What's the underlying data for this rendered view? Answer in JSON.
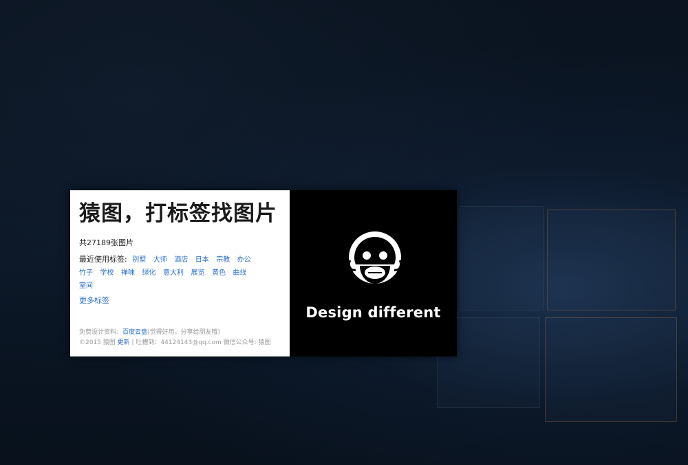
{
  "colors": {
    "link": "#2a6fc9",
    "panel_left_bg": "#ffffff",
    "panel_right_bg": "#000000",
    "wallpaper": "#07101c"
  },
  "card": {
    "title": "猿图，打标签找图片",
    "count_text": "共27189张图片",
    "recent_tags_label": "最近使用标签:",
    "tags": [
      "别墅",
      "大师",
      "酒店",
      "日本",
      "宗教",
      "办公",
      "竹子",
      "学校",
      "禅味",
      "绿化",
      "意大利",
      "展览",
      "黄色",
      "曲线",
      "室间"
    ],
    "more_tags": "更多标签",
    "footer": {
      "line1_prefix": "免费设计资料：",
      "line1_link": "百度云盘",
      "line1_suffix": "(觉得好用，分享给朋友哦)",
      "line2_prefix": "©2015 猿图 ",
      "line2_link": "更新",
      "line2_suffix": " | 吐槽到：44124143@qq.com 微信公众号: 猿图"
    }
  },
  "brand": {
    "logo_icon": "monkey-face-icon",
    "slogan": "Design different"
  }
}
